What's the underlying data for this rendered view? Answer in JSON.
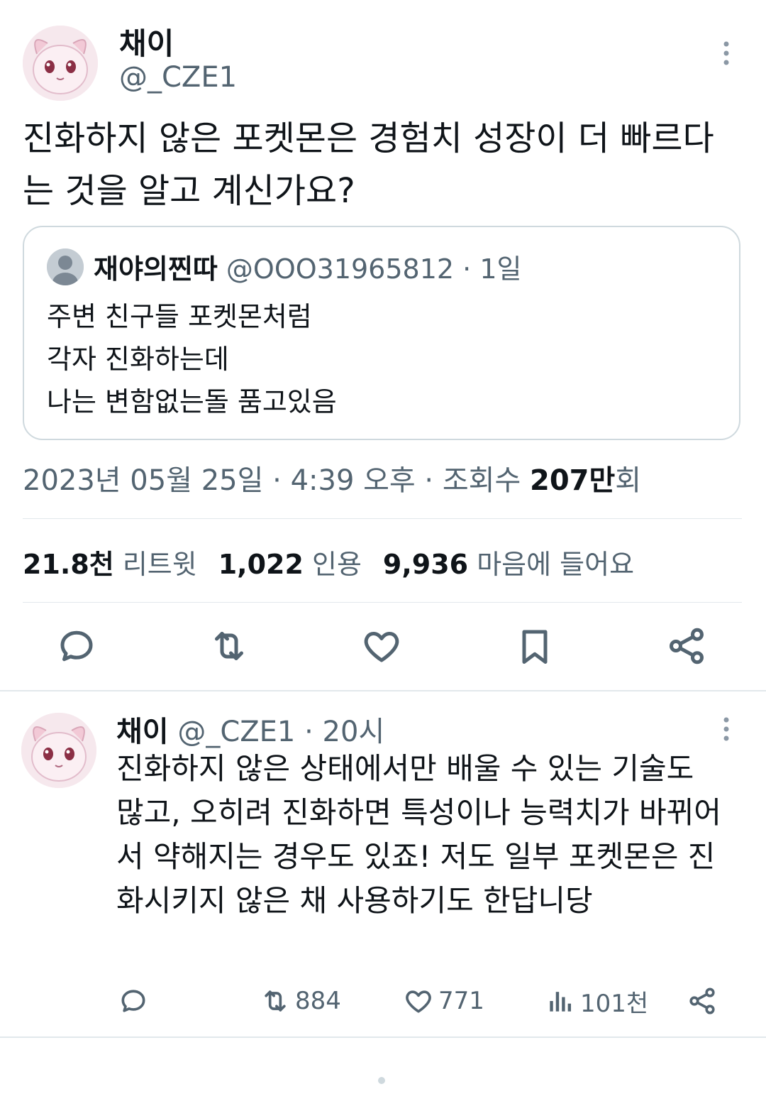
{
  "main_tweet": {
    "author_name": "채이",
    "author_handle": "@_CZE1",
    "text": "진화하지 않은 포켓몬은 경험치 성장이 더 빠르다는 것을 알고 계신가요?",
    "quote": {
      "author_name": "재야의찐따",
      "author_handle": "@OOO31965812",
      "age": "· 1일",
      "text": "주변 친구들 포켓몬처럼\n각자 진화하는데\n나는 변함없는돌 품고있음"
    },
    "timestamp": "2023년 05월 25일 · 4:39 오후 · 조회수",
    "views_count": "207만",
    "views_suffix": "회",
    "stats": {
      "retweets_count": "21.8천",
      "retweets_label": "리트윗",
      "quotes_count": "1,022",
      "quotes_label": "인용",
      "likes_count": "9,936",
      "likes_label": "마음에 들어요"
    }
  },
  "reply": {
    "author_name": "채이",
    "author_handle": "@_CZE1",
    "age": "· 20시",
    "text": "진화하지 않은 상태에서만 배울 수 있는 기술도 많고, 오히려 진화하면 특성이나 능력치가 바뀌어서 약해지는 경우도 있죠! 저도 일부 포켓몬은 진화시키지 않은 채 사용하기도 한답니당",
    "retweets": "884",
    "likes": "771",
    "views": "101천"
  },
  "colors": {
    "text": "#0f1419",
    "muted": "#536471",
    "border": "#cfd9de"
  }
}
